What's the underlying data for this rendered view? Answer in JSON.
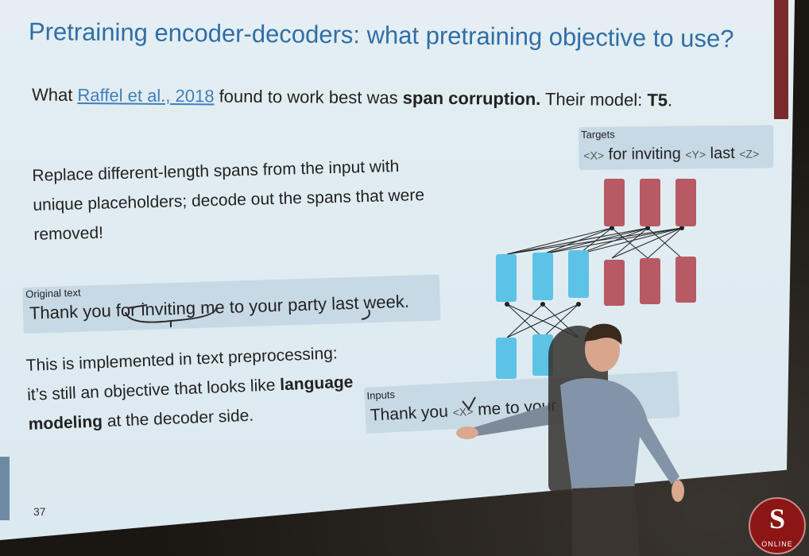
{
  "slide": {
    "title": "Pretraining encoder-decoders: what pretraining objective to use?",
    "intro": {
      "prefix": "What ",
      "link": "Raffel et al., 2018",
      "middle": " found to work best was ",
      "bold": "span corruption.",
      "suffix_prefix": " Their model: ",
      "model": "T5",
      "suffix": "."
    },
    "paragraph1": "Replace different-length spans from the input with unique placeholders; decode out the spans that were removed!",
    "original_text": {
      "label": "Original text",
      "text": "Thank you for inviting me to your party last week."
    },
    "paragraph2": {
      "before": "This is implemented in text preprocessing: it’s still an objective that looks like ",
      "bold": "language modeling",
      "after": " at the decoder side."
    },
    "targets": {
      "label": "Targets",
      "tokens": [
        "<X>",
        " for inviting ",
        "<Y>",
        " last ",
        "<Z>"
      ]
    },
    "inputs": {
      "label": "Inputs",
      "text_start": "Thank you ",
      "token_x": "<X>",
      "text_end": " me to your party <"
    },
    "page_number": "37"
  },
  "logo": {
    "text": "ONLINE",
    "color": "#8c1515"
  }
}
